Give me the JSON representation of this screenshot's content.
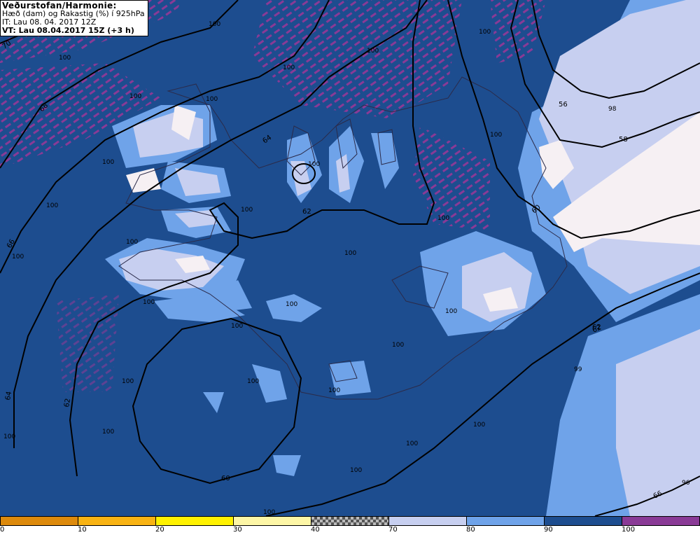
{
  "header": {
    "line1": "Veðurstofan/Harmonie:",
    "line2": "Hæð (dam) og Rakastig (%) í 925hPa",
    "line3": "IT: Lau 08. 04. 2017 12Z",
    "line4": "VT: Lau 08.04.2017 15Z (+3 h)"
  },
  "colors": {
    "ocean": "#1d4d8f",
    "band_80_90": "#6fa3e9",
    "band_70_80": "#c7cff0",
    "band_50": "#f3dada",
    "band_100": "#8a3a96",
    "contour": "#000000"
  },
  "contour_labels": [
    "70",
    "68",
    "66",
    "64",
    "64",
    "62",
    "62",
    "62",
    "60",
    "60",
    "56",
    "58",
    "62",
    "66"
  ],
  "humidity_labels": [
    "100",
    "100",
    "100",
    "100",
    "100",
    "100",
    "100",
    "100",
    "100",
    "100",
    "100",
    "100",
    "100",
    "100",
    "100",
    "100",
    "100",
    "100",
    "100",
    "100",
    "100",
    "100",
    "100",
    "100",
    "100",
    "100",
    "100",
    "100",
    "98",
    "99",
    "96"
  ],
  "legend": {
    "ticks": [
      "0",
      "10",
      "20",
      "30",
      "40",
      "70",
      "80",
      "90",
      "100"
    ],
    "bands": [
      {
        "color": "#dd8a0c",
        "pattern": "solid"
      },
      {
        "color": "#f8b313",
        "pattern": "solid"
      },
      {
        "color": "#fff200",
        "pattern": "solid"
      },
      {
        "color": "#fdf6a6",
        "pattern": "solid"
      },
      {
        "color": "#888888",
        "pattern": "checker"
      },
      {
        "color": "#c7cff0",
        "pattern": "solid"
      },
      {
        "color": "#6fa3e9",
        "pattern": "solid"
      },
      {
        "color": "#1d4d8f",
        "pattern": "solid"
      },
      {
        "color": "#8a3a96",
        "pattern": "solid"
      }
    ]
  }
}
